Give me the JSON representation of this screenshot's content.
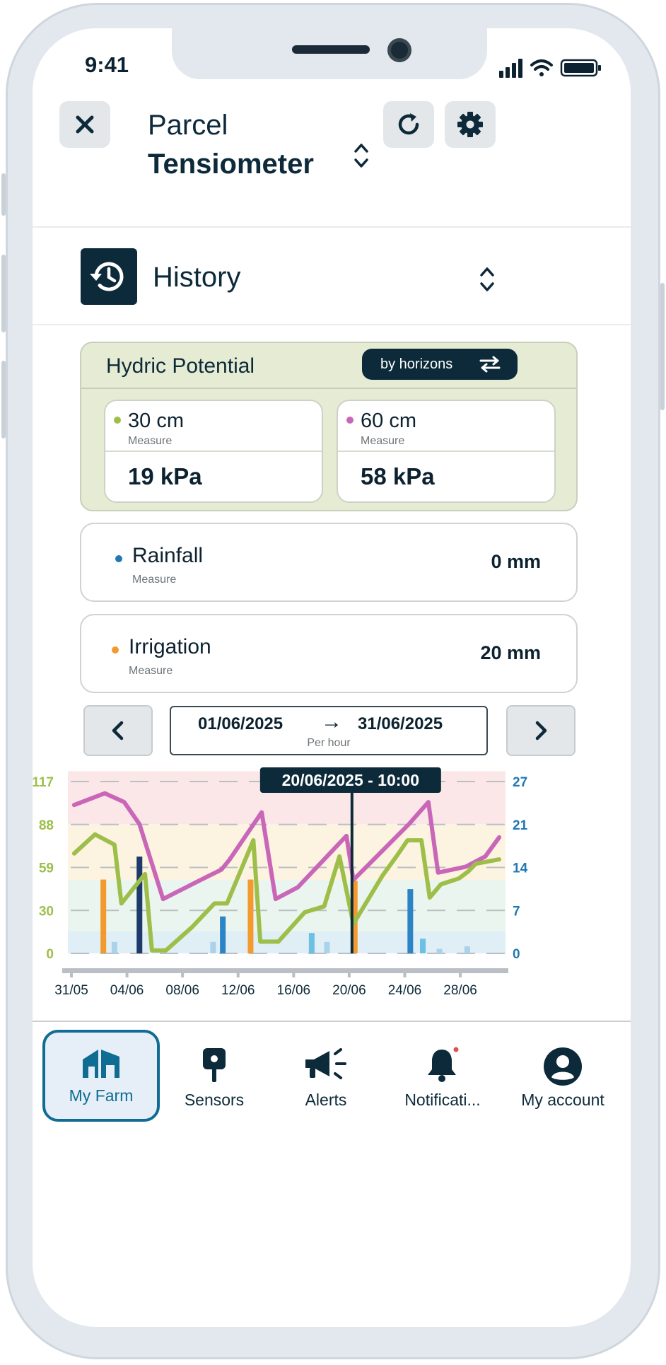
{
  "status": {
    "time": "9:41"
  },
  "header": {
    "parcel_label": "Parcel",
    "sensor_type": "Tensiometer"
  },
  "section": {
    "title": "History"
  },
  "hydric": {
    "title": "Hydric Potential",
    "toggle_label": "by horizons",
    "horizons": [
      {
        "depth": "30 cm",
        "sub": "Measure",
        "value": "19 kPa",
        "color": "#9dbf4a"
      },
      {
        "depth": "60 cm",
        "sub": "Measure",
        "value": "58 kPa",
        "color": "#c966b8"
      }
    ]
  },
  "rainfall": {
    "label": "Rainfall",
    "sub": "Measure",
    "value": "0 mm",
    "color": "#1f78b4"
  },
  "irrigation": {
    "label": "Irrigation",
    "sub": "Measure",
    "value": "20 mm",
    "color": "#f39a2e"
  },
  "date_range": {
    "from": "01/06/2025",
    "to": "31/06/2025",
    "granularity": "Per hour"
  },
  "chart_data": {
    "type": "line",
    "tooltip": "20/06/2025 - 10:00",
    "x_ticks": [
      "31/05",
      "04/06",
      "08/06",
      "12/06",
      "16/06",
      "20/06",
      "24/06",
      "28/06"
    ],
    "x_range": [
      0,
      31
    ],
    "y_left_ticks": [
      "0",
      "30",
      "59",
      "88",
      "117"
    ],
    "y_left_range": [
      0,
      117
    ],
    "y_right_ticks": [
      "0",
      "7",
      "14",
      "21",
      "27"
    ],
    "y_right_range": [
      0,
      27
    ],
    "bands": [
      {
        "from": 88,
        "to": 124,
        "color": "#fbe7e7"
      },
      {
        "from": 50,
        "to": 88,
        "color": "#fdf3e1"
      },
      {
        "from": 15,
        "to": 50,
        "color": "#eaf5ef"
      },
      {
        "from": 0,
        "to": 15,
        "color": "#e0eef5"
      }
    ],
    "series": [
      {
        "name": "60 cm",
        "axis": "left",
        "color": "#c966b8",
        "x": [
          0.2,
          2.4,
          3.8,
          4.9,
          6.6,
          9.1,
          10.8,
          11.4,
          13.7,
          14.7,
          16.3,
          19.8,
          20.3,
          24.3,
          25.7,
          26.4,
          28.4,
          29.8,
          30.8
        ],
        "y": [
          101,
          109,
          103,
          88,
          37,
          49,
          57,
          64,
          96,
          37,
          45,
          80,
          50,
          88,
          103,
          55,
          59,
          66,
          79
        ]
      },
      {
        "name": "30 cm",
        "axis": "left",
        "color": "#9dbf4a",
        "x": [
          0.2,
          1.7,
          3.1,
          3.6,
          5.3,
          5.8,
          6.8,
          8.7,
          10.3,
          11.2,
          13.1,
          13.6,
          14.9,
          16.8,
          18.2,
          19.3,
          20.3,
          22.4,
          23.4,
          24.2,
          25.2,
          25.8,
          26.6,
          27.9,
          28.6,
          29.1,
          30.8
        ],
        "y": [
          68,
          81,
          74,
          34,
          54,
          2,
          2,
          18,
          34,
          34,
          77,
          8,
          8,
          28,
          32,
          66,
          20,
          53,
          66,
          77,
          77,
          38,
          47,
          51,
          56,
          61,
          64
        ]
      },
      {
        "name": "Irrigation",
        "axis": "right",
        "type": "bar",
        "color": "#f39a2e",
        "x": [
          2.2,
          12.8,
          20.3
        ],
        "y": [
          11.6,
          11.6,
          11.4
        ]
      },
      {
        "name": "Rainfall",
        "axis": "right",
        "type": "bar",
        "color": "#2b84c5",
        "x": [
          4.9,
          10.8,
          24.2
        ],
        "y": [
          3.1,
          3.3,
          1.4
        ]
      }
    ],
    "bars": [
      {
        "x": 2.3,
        "y": 11.6,
        "color": "#f39a2e"
      },
      {
        "x": 3.1,
        "y": 1.8,
        "color": "#a9d3ea"
      },
      {
        "x": 4.9,
        "y": 15.2,
        "color": "#1e3a6a"
      },
      {
        "x": 10.2,
        "y": 1.8,
        "color": "#a9d3ea"
      },
      {
        "x": 10.9,
        "y": 5.8,
        "color": "#2b84c5"
      },
      {
        "x": 12.9,
        "y": 11.6,
        "color": "#f39a2e"
      },
      {
        "x": 17.3,
        "y": 3.2,
        "color": "#6bc0e3"
      },
      {
        "x": 18.4,
        "y": 1.8,
        "color": "#a9d3ea"
      },
      {
        "x": 20.4,
        "y": 11.4,
        "color": "#f39a2e"
      },
      {
        "x": 24.4,
        "y": 10.1,
        "color": "#2b84c5"
      },
      {
        "x": 25.3,
        "y": 2.3,
        "color": "#6bc0e3"
      },
      {
        "x": 26.5,
        "y": 0.7,
        "color": "#a9d3ea"
      },
      {
        "x": 28.5,
        "y": 1.1,
        "color": "#a9d3ea"
      }
    ],
    "cursor_x": 20.2,
    "left_axis_color": "#9dbf4a",
    "right_axis_color": "#1f78b4"
  },
  "bottom_nav": [
    {
      "label": "My Farm",
      "icon": "farm-icon",
      "active": true
    },
    {
      "label": "Sensors",
      "icon": "sensor-icon",
      "active": false
    },
    {
      "label": "Alerts",
      "icon": "megaphone-icon",
      "active": false
    },
    {
      "label": "Notificati...",
      "icon": "bell-icon",
      "active": false
    },
    {
      "label": "My account",
      "icon": "account-icon",
      "active": false
    }
  ]
}
